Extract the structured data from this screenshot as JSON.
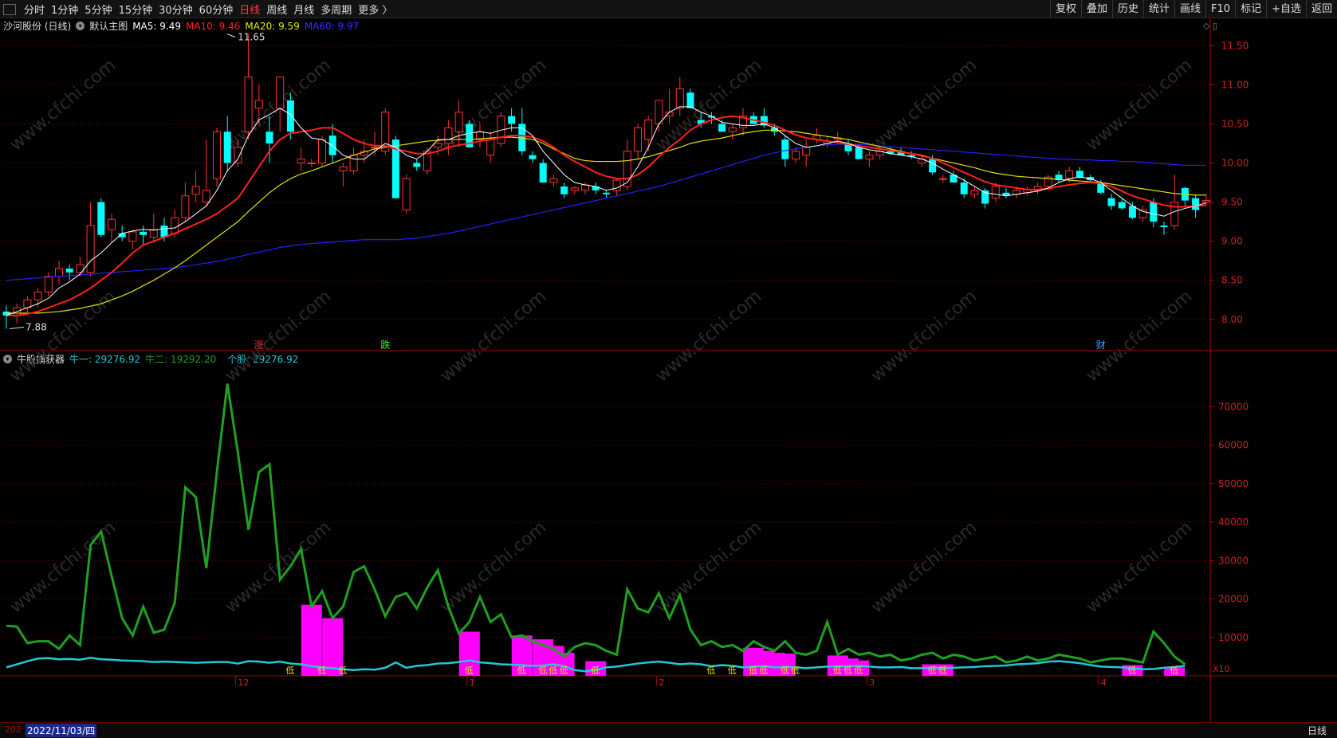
{
  "toolbar": {
    "periods": [
      "分时",
      "1分钟",
      "5分钟",
      "15分钟",
      "30分钟",
      "60分钟",
      "日线",
      "周线",
      "月线",
      "多周期",
      "更多 〉"
    ],
    "active_period": "日线",
    "right_buttons": [
      "复权",
      "叠加",
      "历史",
      "统计",
      "画线",
      "F10",
      "标记",
      "+自选",
      "返回"
    ]
  },
  "main_chart": {
    "stock_name": "沙河股份 (日线)",
    "template": "默认主图",
    "ma5_label": "MA5: 9.49",
    "ma10_label": "MA10: 9.46",
    "ma20_label": "MA20: 9.59",
    "ma60_label": "MA60: 9.97",
    "high_mark": "11.65",
    "low_mark": "7.88",
    "y_ticks": [
      "11.50",
      "11.00",
      "10.50",
      "10.00",
      "9.50",
      "9.00",
      "8.50",
      "8.00"
    ],
    "signals": [
      "涨",
      "跌",
      "财"
    ]
  },
  "sub_chart": {
    "name": "牛股捕获器",
    "niu1_label": "牛一: 29276.92",
    "niu2_label": "牛二: 19292.20",
    "gegu_label": "个股: 29276.92",
    "y_ticks": [
      "70000",
      "60000",
      "50000",
      "40000",
      "30000",
      "20000",
      "10000"
    ],
    "x10": "X10",
    "low_marker": "低"
  },
  "x_axis": {
    "cursor_date": "2022/11/03/四",
    "prefix": "202",
    "month_labels": [
      "12",
      "1",
      "2",
      "3",
      "4"
    ]
  },
  "status": {
    "period": "日线"
  },
  "colors": {
    "up": "#ff3232",
    "down": "#00ffff",
    "ma5": "#ffffff",
    "ma10": "#ff2020",
    "ma20": "#e0e000",
    "ma60": "#2020ff",
    "niu_line": "#20a020",
    "gegu_line": "#20c8d8",
    "bars": "#ff00ff",
    "low_text": "#e0e000",
    "grid": "#5a0000",
    "axis": "#b00000"
  },
  "chart_data": {
    "type": "candlestick",
    "note_series": "daily OHLC and moving averages of 沙河股份, plus 牛股捕获器 indicator",
    "candles": [
      [
        8.1,
        8.18,
        7.88,
        8.05
      ],
      [
        8.05,
        8.2,
        7.95,
        8.15
      ],
      [
        8.15,
        8.3,
        8.08,
        8.25
      ],
      [
        8.25,
        8.4,
        8.15,
        8.35
      ],
      [
        8.35,
        8.6,
        8.3,
        8.55
      ],
      [
        8.55,
        8.75,
        8.45,
        8.65
      ],
      [
        8.65,
        8.7,
        8.5,
        8.6
      ],
      [
        8.6,
        8.8,
        8.55,
        8.7
      ],
      [
        8.6,
        9.5,
        8.55,
        9.2
      ],
      [
        9.5,
        9.55,
        9.05,
        9.08
      ],
      [
        9.15,
        9.35,
        9.0,
        9.28
      ],
      [
        9.1,
        9.2,
        9.0,
        9.05
      ],
      [
        9.0,
        9.15,
        8.9,
        9.12
      ],
      [
        9.12,
        9.2,
        8.95,
        9.08
      ],
      [
        9.05,
        9.35,
        8.98,
        9.15
      ],
      [
        9.2,
        9.3,
        9.0,
        9.05
      ],
      [
        9.1,
        9.4,
        9.05,
        9.3
      ],
      [
        9.3,
        9.75,
        9.25,
        9.58
      ],
      [
        9.6,
        9.9,
        9.5,
        9.7
      ],
      [
        9.5,
        10.3,
        9.45,
        9.65
      ],
      [
        9.8,
        10.45,
        9.7,
        10.4
      ],
      [
        10.4,
        10.6,
        9.9,
        10.0
      ],
      [
        10.0,
        10.3,
        9.95,
        10.2
      ],
      [
        10.4,
        11.65,
        10.3,
        11.1
      ],
      [
        10.7,
        11.0,
        10.5,
        10.8
      ],
      [
        10.4,
        10.6,
        10.0,
        10.25
      ],
      [
        10.7,
        11.1,
        10.4,
        11.1
      ],
      [
        10.8,
        10.9,
        10.3,
        10.4
      ],
      [
        10.0,
        10.2,
        9.9,
        10.05
      ],
      [
        10.0,
        10.05,
        9.95,
        10.0
      ],
      [
        10.0,
        10.35,
        9.95,
        10.3
      ],
      [
        10.35,
        10.5,
        10.0,
        10.1
      ],
      [
        9.9,
        10.0,
        9.7,
        9.95
      ],
      [
        9.9,
        10.2,
        9.85,
        10.1
      ],
      [
        10.1,
        10.3,
        10.0,
        10.15
      ],
      [
        10.2,
        10.4,
        10.1,
        10.2
      ],
      [
        10.15,
        10.7,
        10.1,
        10.65
      ],
      [
        10.3,
        10.35,
        9.55,
        9.55
      ],
      [
        9.4,
        9.85,
        9.35,
        9.8
      ],
      [
        10.0,
        10.05,
        9.9,
        9.95
      ],
      [
        9.9,
        10.2,
        9.85,
        10.15
      ],
      [
        10.2,
        10.35,
        10.1,
        10.25
      ],
      [
        10.25,
        10.55,
        10.1,
        10.45
      ],
      [
        10.4,
        10.8,
        10.2,
        10.65
      ],
      [
        10.5,
        10.55,
        10.2,
        10.2
      ],
      [
        10.3,
        10.5,
        10.2,
        10.4
      ],
      [
        10.1,
        10.4,
        10.0,
        10.3
      ],
      [
        10.25,
        10.65,
        10.2,
        10.6
      ],
      [
        10.6,
        10.7,
        10.4,
        10.5
      ],
      [
        10.5,
        10.7,
        10.1,
        10.15
      ],
      [
        10.1,
        10.15,
        10.0,
        10.05
      ],
      [
        10.0,
        10.05,
        9.75,
        9.75
      ],
      [
        9.75,
        9.85,
        9.7,
        9.8
      ],
      [
        9.7,
        9.75,
        9.55,
        9.6
      ],
      [
        9.65,
        9.7,
        9.6,
        9.68
      ],
      [
        9.65,
        9.75,
        9.6,
        9.72
      ],
      [
        9.7,
        9.75,
        9.6,
        9.65
      ],
      [
        9.62,
        9.65,
        9.55,
        9.6
      ],
      [
        9.65,
        9.8,
        9.58,
        9.78
      ],
      [
        9.7,
        10.3,
        9.65,
        10.15
      ],
      [
        10.15,
        10.5,
        10.05,
        10.45
      ],
      [
        10.3,
        10.6,
        10.15,
        10.55
      ],
      [
        10.5,
        10.8,
        10.4,
        10.8
      ],
      [
        10.6,
        10.95,
        10.5,
        10.65
      ],
      [
        10.7,
        11.1,
        10.6,
        10.95
      ],
      [
        10.9,
        10.95,
        10.7,
        10.7
      ],
      [
        10.55,
        10.65,
        10.45,
        10.5
      ],
      [
        10.6,
        10.65,
        10.5,
        10.58
      ],
      [
        10.5,
        10.55,
        10.4,
        10.4
      ],
      [
        10.4,
        10.5,
        10.3,
        10.45
      ],
      [
        10.45,
        10.7,
        10.35,
        10.6
      ],
      [
        10.6,
        10.65,
        10.5,
        10.5
      ],
      [
        10.6,
        10.7,
        10.45,
        10.48
      ],
      [
        10.45,
        10.5,
        10.35,
        10.4
      ],
      [
        10.3,
        10.35,
        9.95,
        10.05
      ],
      [
        10.05,
        10.2,
        10.0,
        10.15
      ],
      [
        10.1,
        10.3,
        9.95,
        10.2
      ],
      [
        10.3,
        10.45,
        10.25,
        10.35
      ],
      [
        10.25,
        10.35,
        10.2,
        10.28
      ],
      [
        10.3,
        10.4,
        10.25,
        10.32
      ],
      [
        10.25,
        10.3,
        10.1,
        10.15
      ],
      [
        10.2,
        10.25,
        10.05,
        10.05
      ],
      [
        10.05,
        10.15,
        9.95,
        10.1
      ],
      [
        10.1,
        10.2,
        10.05,
        10.15
      ],
      [
        10.15,
        10.2,
        10.1,
        10.12
      ],
      [
        10.15,
        10.2,
        10.1,
        10.1
      ],
      [
        10.1,
        10.15,
        10.05,
        10.08
      ],
      [
        10.0,
        10.1,
        9.95,
        10.05
      ],
      [
        10.05,
        10.1,
        9.85,
        9.88
      ],
      [
        9.8,
        9.85,
        9.75,
        9.8
      ],
      [
        9.85,
        9.9,
        9.75,
        9.75
      ],
      [
        9.75,
        9.8,
        9.55,
        9.6
      ],
      [
        9.6,
        9.7,
        9.55,
        9.65
      ],
      [
        9.65,
        9.68,
        9.42,
        9.48
      ],
      [
        9.55,
        9.75,
        9.5,
        9.7
      ],
      [
        9.62,
        9.68,
        9.55,
        9.58
      ],
      [
        9.6,
        9.7,
        9.55,
        9.65
      ],
      [
        9.62,
        9.7,
        9.58,
        9.66
      ],
      [
        9.65,
        9.75,
        9.6,
        9.7
      ],
      [
        9.7,
        9.85,
        9.65,
        9.82
      ],
      [
        9.85,
        9.9,
        9.75,
        9.78
      ],
      [
        9.8,
        9.95,
        9.75,
        9.9
      ],
      [
        9.9,
        9.95,
        9.8,
        9.82
      ],
      [
        9.82,
        9.85,
        9.75,
        9.78
      ],
      [
        9.75,
        9.78,
        9.6,
        9.62
      ],
      [
        9.55,
        9.6,
        9.4,
        9.45
      ],
      [
        9.5,
        9.55,
        9.4,
        9.42
      ],
      [
        9.45,
        9.5,
        9.28,
        9.3
      ],
      [
        9.3,
        9.45,
        9.25,
        9.4
      ],
      [
        9.5,
        9.55,
        9.18,
        9.25
      ],
      [
        9.2,
        9.25,
        9.08,
        9.18
      ],
      [
        9.2,
        9.85,
        9.15,
        9.5
      ],
      [
        9.68,
        9.7,
        9.45,
        9.52
      ],
      [
        9.55,
        9.6,
        9.3,
        9.4
      ],
      [
        9.5,
        9.6,
        9.45,
        9.52
      ]
    ],
    "ma5": [
      8.05,
      8.1,
      8.15,
      8.2,
      8.27,
      8.4,
      8.48,
      8.58,
      8.75,
      8.85,
      8.98,
      9.1,
      9.13,
      9.15,
      9.14,
      9.16,
      9.17,
      9.25,
      9.35,
      9.45,
      9.65,
      9.9,
      10.05,
      10.35,
      10.55,
      10.62,
      10.7,
      10.62,
      10.45,
      10.32,
      10.3,
      10.22,
      10.1,
      10.05,
      10.05,
      10.15,
      10.25,
      10.2,
      10.1,
      10.05,
      10.15,
      10.3,
      10.3,
      10.35,
      10.38,
      10.4,
      10.38,
      10.42,
      10.45,
      10.45,
      10.35,
      10.15,
      10.0,
      9.85,
      9.75,
      9.72,
      9.7,
      9.65,
      9.68,
      9.75,
      9.95,
      10.2,
      10.5,
      10.65,
      10.72,
      10.72,
      10.65,
      10.6,
      10.52,
      10.5,
      10.48,
      10.48,
      10.5,
      10.45,
      10.35,
      10.25,
      10.2,
      10.22,
      10.25,
      10.28,
      10.25,
      10.2,
      10.17,
      10.15,
      10.12,
      10.1,
      10.08,
      10.05,
      10.0,
      9.92,
      9.85,
      9.78,
      9.7,
      9.62,
      9.6,
      9.58,
      9.6,
      9.62,
      9.64,
      9.68,
      9.75,
      9.8,
      9.82,
      9.8,
      9.75,
      9.65,
      9.55,
      9.45,
      9.38,
      9.35,
      9.32,
      9.38,
      9.42,
      9.45,
      9.49
    ],
    "ma10": [
      8.05,
      8.05,
      8.07,
      8.1,
      8.15,
      8.2,
      8.25,
      8.32,
      8.4,
      8.5,
      8.6,
      8.72,
      8.85,
      8.95,
      9.0,
      9.05,
      9.1,
      9.16,
      9.22,
      9.28,
      9.35,
      9.45,
      9.55,
      9.75,
      9.95,
      10.15,
      10.3,
      10.38,
      10.4,
      10.42,
      10.45,
      10.45,
      10.38,
      10.3,
      10.25,
      10.22,
      10.22,
      10.18,
      10.15,
      10.12,
      10.12,
      10.15,
      10.2,
      10.23,
      10.25,
      10.28,
      10.3,
      10.33,
      10.35,
      10.35,
      10.33,
      10.28,
      10.2,
      10.1,
      10.02,
      9.95,
      9.88,
      9.83,
      9.8,
      9.8,
      9.85,
      9.95,
      10.08,
      10.2,
      10.3,
      10.42,
      10.5,
      10.55,
      10.58,
      10.6,
      10.58,
      10.55,
      10.52,
      10.48,
      10.42,
      10.36,
      10.32,
      10.3,
      10.28,
      10.26,
      10.24,
      10.22,
      10.2,
      10.18,
      10.16,
      10.14,
      10.12,
      10.1,
      10.06,
      10.0,
      9.94,
      9.88,
      9.82,
      9.76,
      9.72,
      9.7,
      9.68,
      9.66,
      9.66,
      9.67,
      9.7,
      9.72,
      9.74,
      9.75,
      9.74,
      9.7,
      9.64,
      9.58,
      9.54,
      9.5,
      9.46,
      9.44,
      9.44,
      9.45,
      9.46
    ],
    "ma20": [
      8.08,
      8.08,
      8.08,
      8.08,
      8.09,
      8.1,
      8.12,
      8.14,
      8.17,
      8.2,
      8.25,
      8.3,
      8.36,
      8.43,
      8.5,
      8.58,
      8.66,
      8.75,
      8.85,
      8.95,
      9.05,
      9.15,
      9.25,
      9.38,
      9.5,
      9.62,
      9.72,
      9.8,
      9.86,
      9.9,
      9.95,
      10.0,
      10.05,
      10.1,
      10.14,
      10.18,
      10.2,
      10.22,
      10.24,
      10.26,
      10.28,
      10.29,
      10.3,
      10.3,
      10.3,
      10.31,
      10.32,
      10.33,
      10.33,
      10.32,
      10.3,
      10.25,
      10.18,
      10.12,
      10.06,
      10.03,
      10.02,
      10.02,
      10.02,
      10.03,
      10.05,
      10.08,
      10.12,
      10.16,
      10.2,
      10.25,
      10.28,
      10.3,
      10.32,
      10.35,
      10.38,
      10.4,
      10.42,
      10.42,
      10.41,
      10.4,
      10.38,
      10.36,
      10.34,
      10.32,
      10.3,
      10.27,
      10.24,
      10.21,
      10.18,
      10.15,
      10.12,
      10.09,
      10.06,
      10.03,
      10.0,
      9.97,
      9.94,
      9.9,
      9.87,
      9.85,
      9.83,
      9.82,
      9.81,
      9.8,
      9.79,
      9.78,
      9.77,
      9.76,
      9.75,
      9.73,
      9.71,
      9.69,
      9.67,
      9.65,
      9.63,
      9.61,
      9.6,
      9.59,
      9.59
    ],
    "ma60": [
      8.5,
      8.51,
      8.52,
      8.53,
      8.54,
      8.55,
      8.56,
      8.57,
      8.58,
      8.59,
      8.6,
      8.61,
      8.62,
      8.63,
      8.64,
      8.65,
      8.66,
      8.68,
      8.7,
      8.72,
      8.74,
      8.77,
      8.8,
      8.83,
      8.86,
      8.89,
      8.92,
      8.94,
      8.96,
      8.97,
      8.98,
      8.99,
      9.0,
      9.01,
      9.02,
      9.02,
      9.02,
      9.02,
      9.03,
      9.04,
      9.06,
      9.08,
      9.1,
      9.13,
      9.16,
      9.19,
      9.22,
      9.25,
      9.28,
      9.31,
      9.34,
      9.37,
      9.4,
      9.43,
      9.46,
      9.49,
      9.52,
      9.55,
      9.58,
      9.61,
      9.64,
      9.67,
      9.7,
      9.74,
      9.78,
      9.82,
      9.86,
      9.9,
      9.94,
      9.98,
      10.02,
      10.06,
      10.1,
      10.13,
      10.16,
      10.18,
      10.2,
      10.22,
      10.23,
      10.24,
      10.24,
      10.24,
      10.23,
      10.22,
      10.21,
      10.2,
      10.19,
      10.18,
      10.17,
      10.16,
      10.15,
      10.14,
      10.13,
      10.12,
      10.11,
      10.1,
      10.09,
      10.08,
      10.07,
      10.06,
      10.05,
      10.05,
      10.04,
      10.04,
      10.03,
      10.03,
      10.02,
      10.02,
      10.01,
      10.0,
      9.99,
      9.98,
      9.97,
      9.97,
      9.97
    ],
    "niu_line": [
      13000,
      12800,
      8500,
      9000,
      9000,
      7000,
      10500,
      8000,
      34000,
      37500,
      26000,
      15000,
      10500,
      18000,
      11200,
      12000,
      19000,
      49000,
      46500,
      28000,
      53000,
      76000,
      58000,
      38000,
      53000,
      55000,
      25000,
      28500,
      33000,
      18000,
      22000,
      15000,
      18000,
      27000,
      28500,
      22500,
      15500,
      20500,
      21500,
      17500,
      23000,
      27500,
      18000,
      11000,
      14000,
      20500,
      14000,
      16000,
      10000,
      10500,
      9000,
      8000,
      7000,
      5000,
      7500,
      8500,
      8000,
      6500,
      5500,
      22500,
      17500,
      16500,
      21500,
      15000,
      21000,
      12000,
      8000,
      9000,
      7500,
      8000,
      6500,
      9000,
      7500,
      6500,
      9000,
      6000,
      5500,
      6500,
      14000,
      5500,
      7000,
      5500,
      6000,
      5000,
      5500,
      4000,
      4500,
      5500,
      6000,
      4500,
      5500,
      5000,
      4000,
      4500,
      5000,
      3500,
      4000,
      5000,
      4000,
      4500,
      5500,
      5000,
      4500,
      3500,
      4000,
      4500,
      4500,
      4000,
      3500,
      11500,
      8500,
      5000,
      3000
    ],
    "gegu_line": [
      2200,
      3000,
      3800,
      4500,
      4600,
      4300,
      4400,
      4200,
      4700,
      4300,
      4200,
      4000,
      3900,
      3800,
      3600,
      3700,
      3600,
      3500,
      3400,
      3500,
      3600,
      3600,
      3200,
      3800,
      3700,
      3400,
      3700,
      3200,
      3000,
      2500,
      2200,
      2000,
      1700,
      1500,
      1700,
      1600,
      2100,
      3500,
      2100,
      2600,
      2800,
      3200,
      3300,
      3600,
      4000,
      3500,
      3300,
      3000,
      2900,
      2800,
      2600,
      2700,
      3000,
      2500,
      1500,
      1200,
      1500,
      2200,
      2400,
      2800,
      3200,
      3500,
      3700,
      3400,
      3000,
      3200,
      3000,
      2500,
      2800,
      2600,
      2200,
      2400,
      2500,
      2200,
      2300,
      2200,
      2000,
      2200,
      2400,
      2500,
      2500,
      2600,
      2400,
      2200,
      2200,
      2300,
      2000,
      2000,
      2100,
      2000,
      2100,
      2200,
      2300,
      2500,
      2600,
      2700,
      3000,
      3100,
      3300,
      3700,
      3800,
      3600,
      3300,
      2800,
      2400,
      2300,
      2200,
      2000,
      1700,
      1800,
      2100,
      2300,
      2600
    ],
    "bars": [
      [
        29,
        18500
      ],
      [
        31,
        15000
      ],
      [
        44,
        11500
      ],
      [
        49,
        10500
      ],
      [
        51,
        9500
      ],
      [
        52,
        7800
      ],
      [
        53,
        6000
      ],
      [
        56,
        3800
      ],
      [
        71,
        7300
      ],
      [
        72,
        6500
      ],
      [
        73,
        6000
      ],
      [
        74,
        5800
      ],
      [
        79,
        5300
      ],
      [
        80,
        4500
      ],
      [
        81,
        4000
      ],
      [
        88,
        3000
      ],
      [
        89,
        3000
      ],
      [
        107,
        2800
      ],
      [
        111,
        2200
      ]
    ],
    "low_markers": [
      27,
      30,
      32,
      44,
      49,
      51,
      52,
      53,
      56,
      67,
      69,
      71,
      72,
      74,
      75,
      79,
      80,
      81,
      88,
      89,
      107,
      111
    ],
    "signals": [
      {
        "i": 24,
        "text": "涨"
      },
      {
        "i": 36,
        "text": "跌"
      },
      {
        "i": 104,
        "text": "财"
      }
    ],
    "y_main_range": [
      7.6,
      11.85
    ],
    "y_sub_range": [
      0,
      80000
    ]
  }
}
